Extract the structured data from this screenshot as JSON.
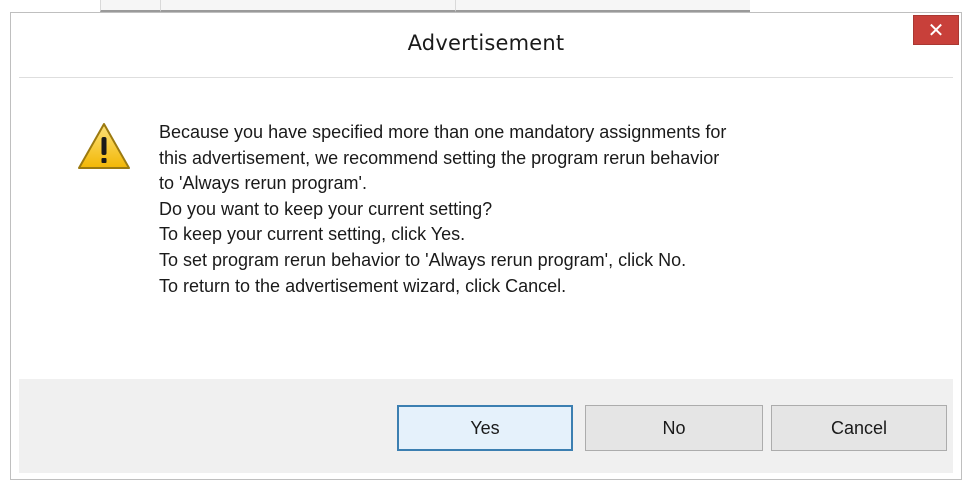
{
  "dialog": {
    "title": "Advertisement",
    "close_label": "✕",
    "message_lines": [
      "Because you have specified more than one mandatory assignments for",
      "this advertisement, we recommend setting the program rerun behavior",
      "to 'Always rerun program'.",
      "Do you want to keep your current setting?",
      "To keep your current setting, click Yes.",
      "To set program rerun behavior to 'Always rerun program', click No.",
      "To return to the advertisement wizard, click Cancel."
    ],
    "icon": "warning-icon",
    "buttons": {
      "yes": "Yes",
      "no": "No",
      "cancel": "Cancel"
    }
  },
  "colors": {
    "close_bg": "#c8403a",
    "footer_bg": "#f0f0f0",
    "default_button_border": "#3c7fb1",
    "warning_fill": "#f5c518"
  }
}
